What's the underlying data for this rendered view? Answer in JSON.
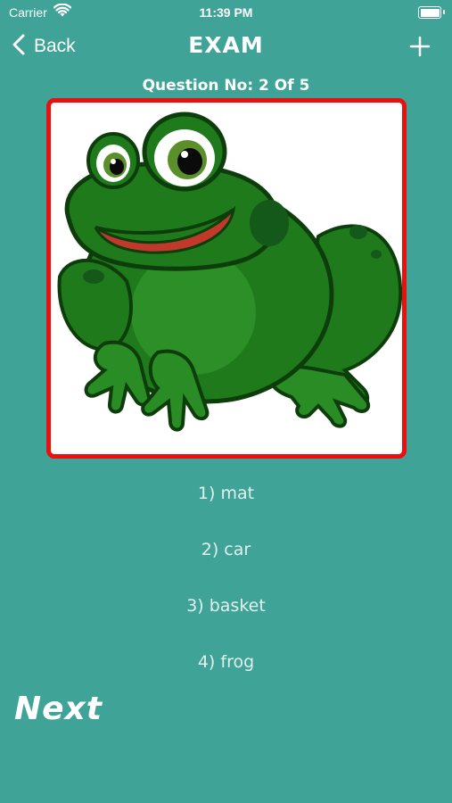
{
  "status_bar": {
    "carrier": "Carrier",
    "time": "11:39 PM",
    "wifi_icon": "wifi-icon",
    "battery_icon": "battery-icon"
  },
  "nav": {
    "back_label": "Back",
    "title": "EXAM",
    "back_icon": "chevron-left-icon",
    "add_icon": "plus-icon"
  },
  "question": {
    "label": "Question No: 2 Of 5"
  },
  "image": {
    "subject": "frog illustration",
    "border_color": "#e8110f"
  },
  "options": [
    {
      "label": "1) mat"
    },
    {
      "label": "2) car"
    },
    {
      "label": "3) basket"
    },
    {
      "label": "4) frog"
    }
  ],
  "next_label": "Next",
  "colors": {
    "background": "#3fa397",
    "frame_border": "#e8110f",
    "frog_green": "#1f7a1c"
  }
}
